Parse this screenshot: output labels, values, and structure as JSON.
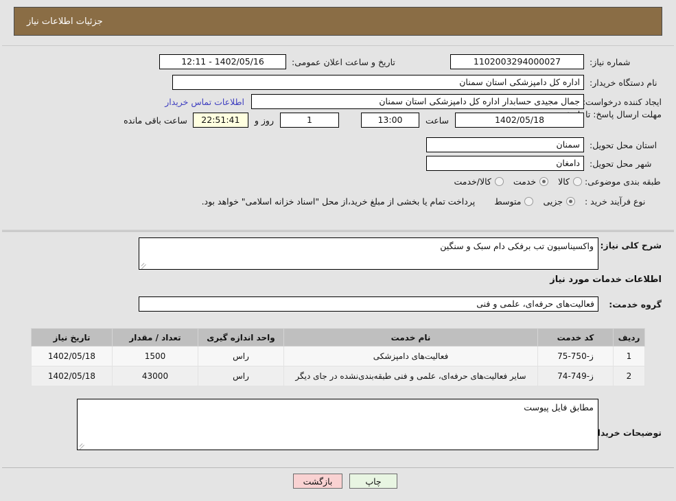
{
  "header": {
    "title": "جزئیات اطلاعات نیاز"
  },
  "info": {
    "need_number_label": "شماره نیاز:",
    "need_number_value": "1102003294000027",
    "announce_label": "تاریخ و ساعت اعلان عمومی:",
    "announce_value": "1402/05/16 - 12:11",
    "buyer_org_label": "نام دستگاه خریدار:",
    "buyer_org_value": "اداره کل دامپزشکی استان سمنان",
    "creator_label": "ایجاد کننده درخواست:",
    "creator_value": "جمال مجیدی حسابدار اداره کل دامپزشکی استان سمنان",
    "contact_link": "اطلاعات تماس خریدار",
    "deadline_label": "مهلت ارسال پاسخ: تا تاریخ:",
    "deadline_date": "1402/05/18",
    "hour_label": "ساعت",
    "deadline_time": "13:00",
    "days_value": "1",
    "days_suffix": "روز و",
    "countdown": "22:51:41",
    "countdown_suffix": "ساعت باقی مانده",
    "province_label": "استان محل تحویل:",
    "province_value": "سمنان",
    "city_label": "شهر محل تحویل:",
    "city_value": "دامغان",
    "category_label": "طبقه بندی موضوعی:",
    "category_options": [
      "کالا",
      "خدمت",
      "کالا/خدمت"
    ],
    "category_selected_index": 1,
    "process_label": "نوع فرآیند خرید :",
    "process_options": [
      "جزیی",
      "متوسط"
    ],
    "process_selected_index": 0,
    "payment_note": "پرداخت تمام یا بخشی از مبلغ خرید،از محل \"اسناد خزانه اسلامی\" خواهد بود."
  },
  "description": {
    "label": "شرح کلی نیاز:",
    "value": "واکسیناسیون تب برفکی دام سبک و سنگین"
  },
  "services": {
    "section_title": "اطلاعات خدمات مورد نیاز",
    "group_label": "گروه خدمت:",
    "group_value": "فعالیت‌های حرفه‌ای، علمی و فنی",
    "columns": [
      "ردیف",
      "کد خدمت",
      "نام خدمت",
      "واحد اندازه گیری",
      "تعداد / مقدار",
      "تاریخ نیاز"
    ],
    "rows": [
      {
        "index": "1",
        "code": "ز-750-75",
        "name": "فعالیت‌های دامپزشکی",
        "unit": "راس",
        "quantity": "1500",
        "date": "1402/05/18"
      },
      {
        "index": "2",
        "code": "ز-749-74",
        "name": "سایر فعالیت‌های حرفه‌ای، علمی و فنی طبقه‌بندی‌نشده در جای دیگر",
        "unit": "راس",
        "quantity": "43000",
        "date": "1402/05/18"
      }
    ]
  },
  "comments": {
    "label": "توضیحات خریدار:",
    "value": "مطابق فایل پیوست"
  },
  "footer": {
    "print_label": "چاپ",
    "back_label": "بازگشت"
  },
  "colors": {
    "header_bg": "#8a6d45",
    "page_bg": "#e4e4e4",
    "link": "#4040c0",
    "timer_bg": "#ffffe0",
    "print_bg": "#e8f5e2",
    "back_bg": "#f9d2d2",
    "table_header_bg": "#bfbfbf"
  }
}
